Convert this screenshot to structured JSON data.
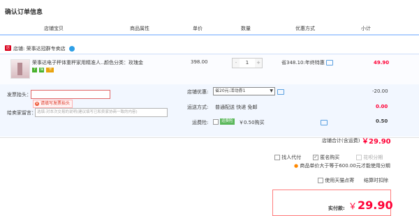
{
  "page": {
    "title": "确认订单信息"
  },
  "columns": [
    "店铺宝贝",
    "商品属性",
    "单价",
    "数量",
    "优惠方式",
    "小计"
  ],
  "shop": {
    "icon": "tmall-shop-icon",
    "label": "店铺:",
    "name": "荣事达冠群专卖店"
  },
  "item": {
    "name": "荣事达电子秤体重秤家用精准人...",
    "attr": "颜色分类：玫瑰金",
    "price": "398.00",
    "quantity": "1",
    "minus": "-",
    "plus": "+",
    "promo": "省348.10:年终特惠",
    "subtotal": "49.90",
    "badges": [
      "7",
      "保",
      "卡"
    ]
  },
  "invoice": {
    "label": "发票抬头：",
    "value": "",
    "error": "请填写发票抬头"
  },
  "message": {
    "label": "给卖家留言：",
    "placeholder": "选填:对本次交易的说明(建议填写已和卖家协商一致的内容)"
  },
  "discount": {
    "label": "店铺优惠:",
    "selected": "省20元:活动券1",
    "amount": "-20.00"
  },
  "shipping": {
    "label": "运送方式:",
    "method": "普通配送 快递 免邮",
    "amount": "0.00"
  },
  "insurance": {
    "label": "运费险:",
    "tag": "运费险",
    "price": "￥0.50购买",
    "amount": "0.50"
  },
  "shop_total": {
    "label": "店铺合计(含运费)",
    "value": "￥29.90"
  },
  "options": {
    "proxy_pay": "找人代付",
    "anonymous": "匿名购买",
    "huabei": "花呗分期",
    "huabei_note": "商品单价大于等于600.00元才能使用分期",
    "pickup": "使用天猫点寄",
    "pickup_right": "结算时扣除"
  },
  "pay": {
    "label": "实付款:",
    "currency": "￥",
    "value": "29.90"
  },
  "colors": {
    "accent": "#ff0036",
    "header_line": "#b2d1ff",
    "option_bg": "#f2f7ff"
  }
}
